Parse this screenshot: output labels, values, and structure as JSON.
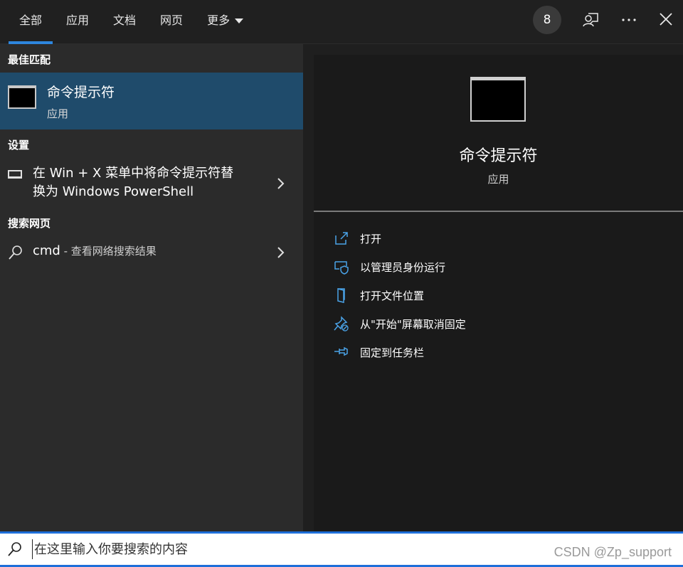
{
  "tabs": [
    {
      "label": "全部"
    },
    {
      "label": "应用"
    },
    {
      "label": "文档"
    },
    {
      "label": "网页"
    },
    {
      "label": "更多"
    }
  ],
  "top": {
    "badge_count": "8"
  },
  "left": {
    "best_match_header": "最佳匹配",
    "best_match": {
      "title": "命令提示符",
      "subtitle": "应用"
    },
    "settings_header": "设置",
    "settings_item": {
      "line1": "在 Win + X 菜单中将命令提示符替",
      "line2": "换为 Windows PowerShell"
    },
    "web_header": "搜索网页",
    "web_item": {
      "query": "cmd",
      "suffix": " - 查看网络搜索结果"
    }
  },
  "preview": {
    "title": "命令提示符",
    "subtitle": "应用",
    "actions": [
      {
        "label": "打开",
        "icon": "open-icon"
      },
      {
        "label": "以管理员身份运行",
        "icon": "shield-icon"
      },
      {
        "label": "打开文件位置",
        "icon": "file-location-icon"
      },
      {
        "label": "从\"开始\"屏幕取消固定",
        "icon": "unpin-icon"
      },
      {
        "label": "固定到任务栏",
        "icon": "pin-icon"
      }
    ]
  },
  "search": {
    "placeholder": "在这里输入你要搜索的内容",
    "value": ""
  },
  "watermark": "CSDN @Zp_support",
  "colors": {
    "accent": "#2e86de",
    "selected_bg": "#1f4b6b",
    "pane_left": "#2b2b2b",
    "pane_right": "#1a1a1a"
  }
}
